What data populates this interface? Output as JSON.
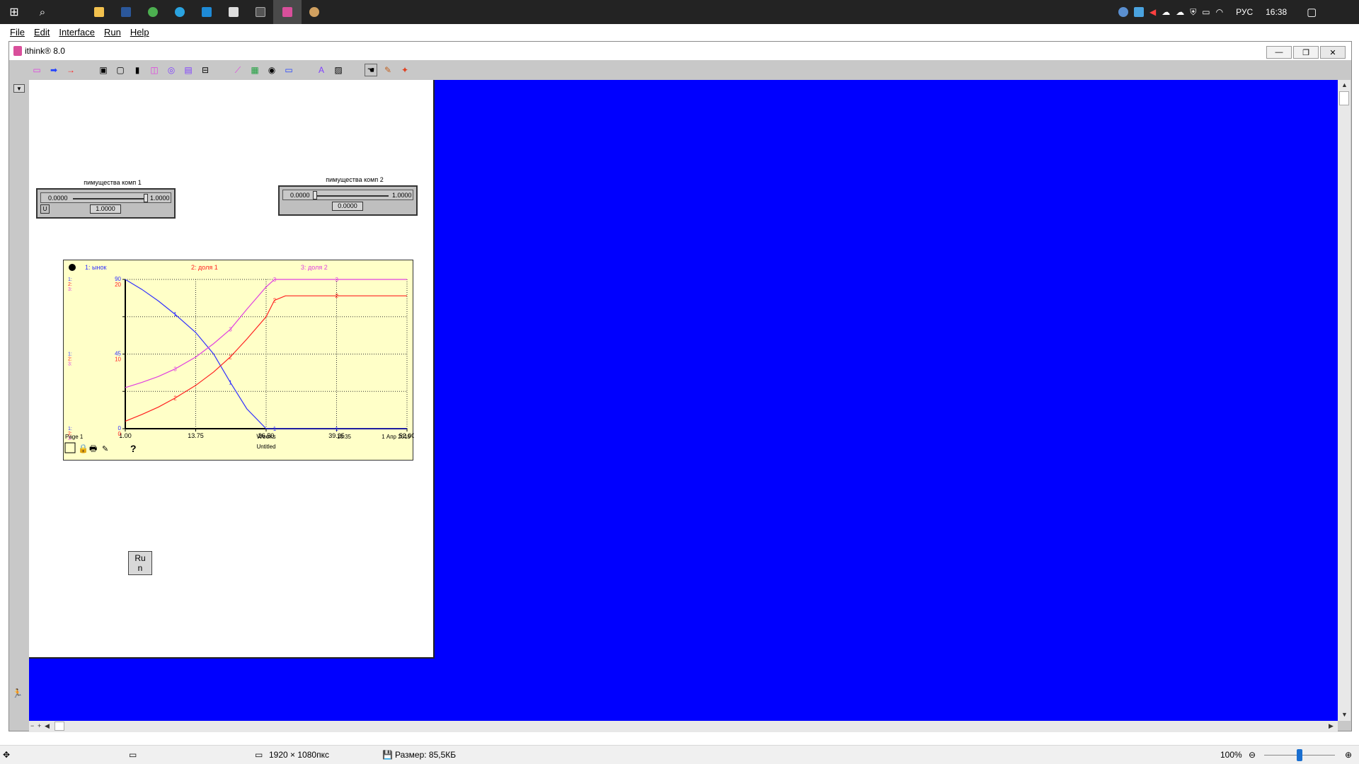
{
  "taskbar": {
    "apps": [
      {
        "name": "windows-start-icon",
        "glyph": "⊞"
      },
      {
        "name": "search-icon",
        "glyph": "⌕"
      },
      {
        "name": "file-explorer-icon",
        "color": "#f2c14e"
      },
      {
        "name": "word-icon",
        "color": "#2b579a"
      },
      {
        "name": "chrome-icon",
        "color": "#4caf50"
      },
      {
        "name": "telegram-icon",
        "color": "#2aa3e0"
      },
      {
        "name": "vscode-icon",
        "color": "#1e8ad6"
      },
      {
        "name": "app-icon",
        "color": "#dddddd"
      },
      {
        "name": "terminal-icon",
        "color": "#555555"
      },
      {
        "name": "ithink-taskbar-icon",
        "color": "#d94f9b"
      },
      {
        "name": "paint-icon",
        "color": "#d0a060"
      }
    ],
    "language": "РУС",
    "time": "16:38"
  },
  "outer_menu": [
    "File",
    "Edit",
    "Interface",
    "Run",
    "Help"
  ],
  "window": {
    "title": "ithink® 8.0"
  },
  "sliders": [
    {
      "title": "пимущества комп 1",
      "min": "0.0000",
      "max": "1.0000",
      "value": "1.0000",
      "level": 1.0
    },
    {
      "title": "пимущества комп 2",
      "min": "0.0000",
      "max": "1.0000",
      "value": "0.0000",
      "level": 0.0
    }
  ],
  "slider_u_label": "U",
  "run_button": {
    "label_line1": "Ru",
    "label_line2": "n"
  },
  "chart_data": {
    "type": "line",
    "x": [
      1.0,
      4.0,
      7.0,
      10.0,
      13.75,
      17.0,
      20.0,
      23.0,
      26.5,
      28.0,
      30.0,
      33.0,
      36.0,
      39.25,
      42.0,
      45.0,
      48.0,
      52.0
    ],
    "xticks": [
      "1.00",
      "13.75",
      "26.50",
      "39.25",
      "52.00"
    ],
    "xlabel": "Weeks",
    "series": [
      {
        "name": "1: ынок",
        "color": "#3030ff",
        "values": [
          90,
          84,
          77,
          69,
          58,
          45,
          28,
          12,
          0,
          0,
          0,
          0,
          0,
          0,
          0,
          0,
          0,
          0
        ],
        "ymax": 90,
        "yticks": [
          "90",
          "45",
          "0"
        ]
      },
      {
        "name": "2: доля 1",
        "color": "#ff2020",
        "values": [
          1,
          1.9,
          2.9,
          4.1,
          5.8,
          7.6,
          9.6,
          12.0,
          15.0,
          17.2,
          17.8,
          17.8,
          17.8,
          17.8,
          17.8,
          17.8,
          17.8,
          17.8
        ],
        "ymax": 20,
        "yticks": [
          "20",
          "10",
          "0"
        ]
      },
      {
        "name": "3: доля 2",
        "color": "#e040e0",
        "values": [
          5.5,
          6.2,
          7.0,
          8.0,
          9.6,
          11.4,
          13.3,
          16.0,
          19.0,
          20,
          20,
          20,
          20,
          20,
          20,
          20,
          20,
          20
        ],
        "ymax": 20,
        "yticks": [
          "20",
          "10",
          "0"
        ]
      }
    ],
    "page_label": "Page 1",
    "time_stamp": "16:35",
    "date_stamp": "1 Апр 2019",
    "footer": "Untitled",
    "grid": true
  },
  "statusbar": {
    "dimensions": "1920 × 1080пкс",
    "size": "Размер: 85,5КБ",
    "zoom": "100%"
  }
}
